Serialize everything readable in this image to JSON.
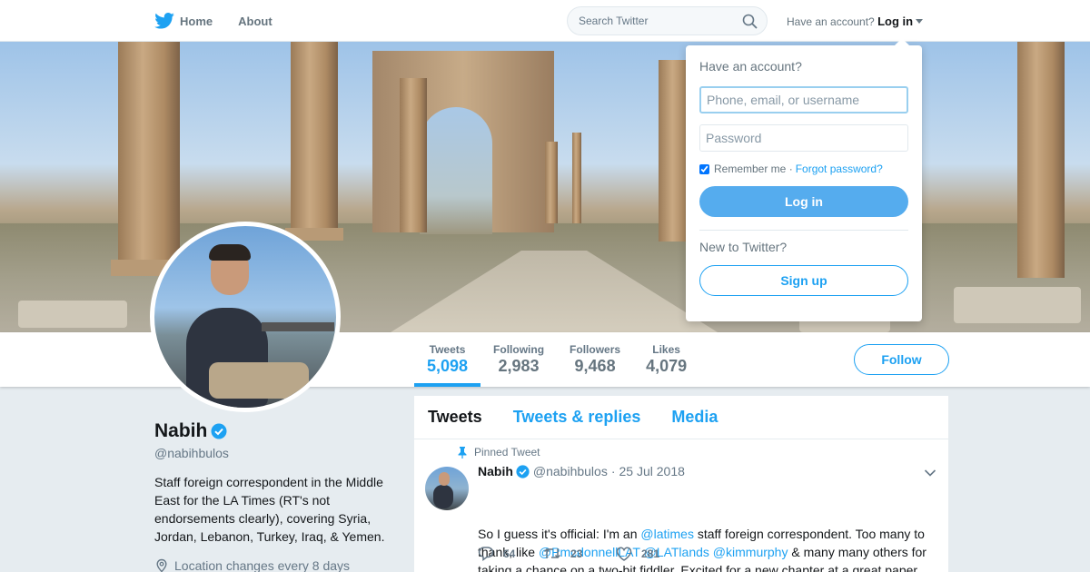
{
  "nav": {
    "home_label": "Home",
    "about_label": "About",
    "search_placeholder": "Search Twitter",
    "have_account_text": "Have an account?",
    "login_label": "Log in"
  },
  "login_dropdown": {
    "title": "Have an account?",
    "username_placeholder": "Phone, email, or username",
    "password_placeholder": "Password",
    "remember_label": "Remember me",
    "separator": "·",
    "forgot_label": "Forgot password?",
    "login_button": "Log in",
    "new_label": "New to Twitter?",
    "signup_button": "Sign up"
  },
  "stats": {
    "tweets_label": "Tweets",
    "tweets_value": "5,098",
    "following_label": "Following",
    "following_value": "2,983",
    "followers_label": "Followers",
    "followers_value": "9,468",
    "likes_label": "Likes",
    "likes_value": "4,079"
  },
  "follow_label": "Follow",
  "profile": {
    "name": "Nabih",
    "handle": "@nabihbulos",
    "bio": "Staff foreign correspondent in the Middle East for the LA Times (RT's not endorsements clearly), covering Syria, Jordan, Lebanon, Turkey, Iraq, & Yemen.",
    "location": "Location changes every 8 days"
  },
  "timeline": {
    "tabs": [
      "Tweets",
      "Tweets & replies",
      "Media"
    ]
  },
  "tweet": {
    "pinned_label": "Pinned Tweet",
    "name": "Nabih",
    "handle": "@nabihbulos",
    "separator": "·",
    "date": "25 Jul 2018",
    "text_1": "So I guess it's official: I'm an ",
    "mention_1": "@latimes",
    "text_2": " staff foreign correspondent. Too many to thank, like ",
    "mention_2": "@PmcdonnellLAT",
    "mention_3": "@LATlands",
    "mention_4": "@kimmurphy",
    "text_3": " & many many others for taking a chance on a two-bit fiddler. Excited for a new chapter at a great paper.",
    "replies": "64",
    "retweets": "23",
    "likes": "281"
  },
  "colors": {
    "accent": "#1da1f2",
    "login_button": "#55acee",
    "page_bg": "#e6ecf0"
  }
}
